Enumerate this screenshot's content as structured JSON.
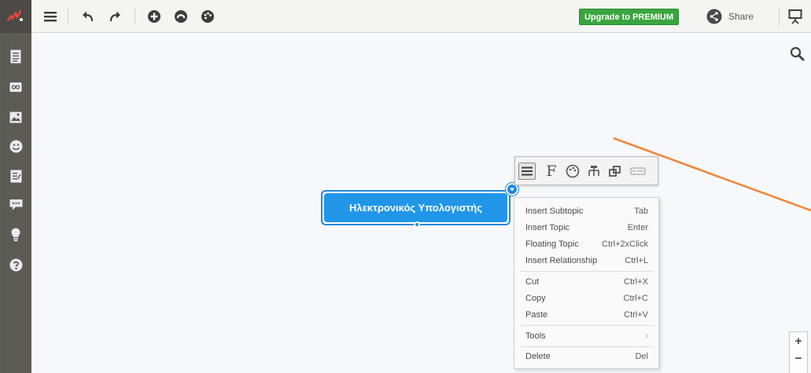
{
  "toolbar": {
    "upgrade_label": "Upgrade to PREMIUM",
    "share_label": "Share",
    "icons": [
      "menu-icon",
      "undo-icon",
      "redo-icon",
      "add-topic-icon",
      "style-icon",
      "theme-palette-icon",
      "share-icon",
      "present-icon"
    ]
  },
  "sidebar": {
    "icons": [
      "outline-icon",
      "link-icon",
      "image-icon",
      "emoji-icon",
      "notes-icon",
      "comments-icon",
      "idea-icon",
      "help-icon"
    ]
  },
  "topic": {
    "label": "Ηλεκτρονικός Υπολογιστής"
  },
  "format_bar": {
    "font_label": "F",
    "icons": [
      "menu-icon",
      "font-icon",
      "palette-icon",
      "structure-icon",
      "shape-icon",
      "text-style-icon"
    ]
  },
  "context_menu": {
    "items": [
      {
        "label": "Insert Subtopic",
        "shortcut": "Tab"
      },
      {
        "label": "Insert Topic",
        "shortcut": "Enter"
      },
      {
        "label": "Floating Topic",
        "shortcut": "Ctrl+2xClick"
      },
      {
        "label": "Insert Relationship",
        "shortcut": "Ctrl+L"
      },
      {
        "label": "Cut",
        "shortcut": "Ctrl+X"
      },
      {
        "label": "Copy",
        "shortcut": "Ctrl+C"
      },
      {
        "label": "Paste",
        "shortcut": "Ctrl+V"
      },
      {
        "label": "Tools",
        "shortcut": "›"
      },
      {
        "label": "Delete",
        "shortcut": "Del"
      }
    ]
  },
  "zoom": {
    "in_label": "+",
    "out_label": "−"
  },
  "colors": {
    "accent": "#2196e9",
    "upgrade": "#3aa53f",
    "relationship_line": "#f0883c",
    "sidebar": "#5a5954"
  }
}
